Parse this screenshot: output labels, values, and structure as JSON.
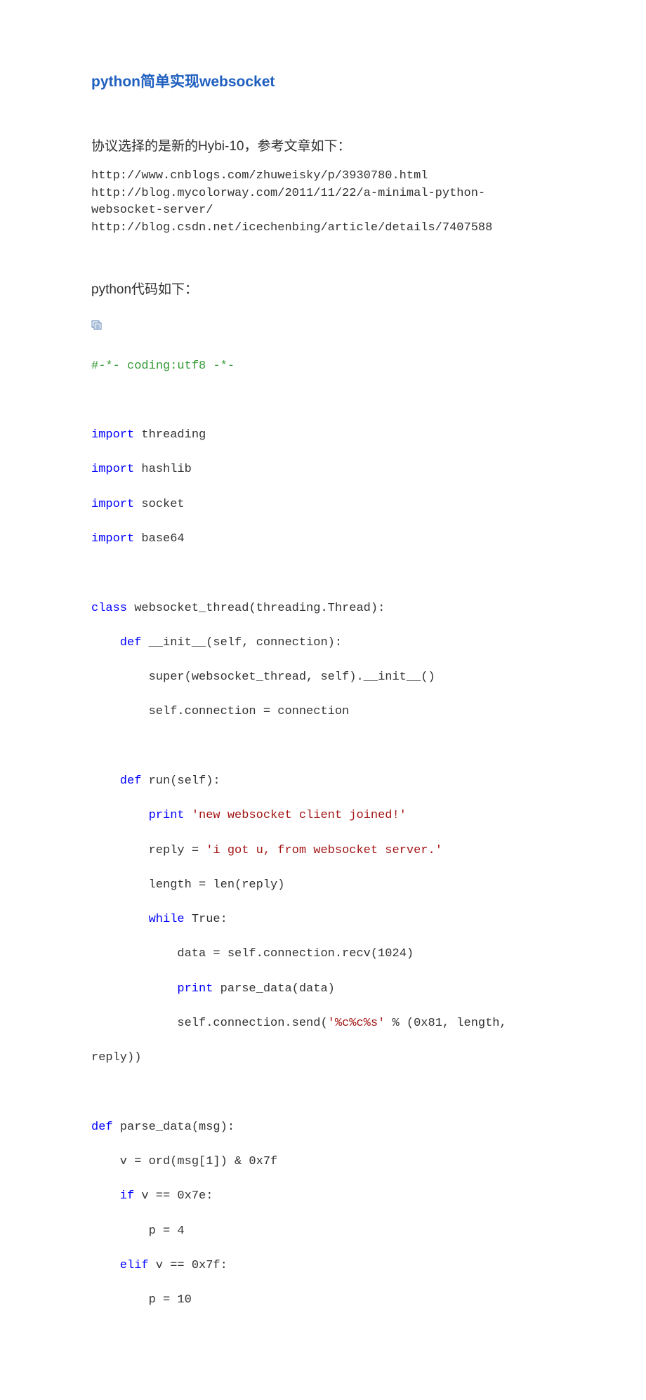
{
  "title": "python简单实现websocket",
  "intro": "协议选择的是新的Hybi-10，参考文章如下：",
  "urls": {
    "u1": "http://www.cnblogs.com/zhuweisky/p/3930780.html",
    "u2a": "http://blog.mycolorway.com/2011/11/22/a-minimal-python-",
    "u2b": "websocket-server/",
    "u3": "http://blog.csdn.net/icechenbing/article/details/7407588"
  },
  "code_heading": "python代码如下：",
  "code": {
    "coding_comment": "#-*- coding:utf8 -*-",
    "imp": "import",
    "threading": " threading",
    "hashlib": " hashlib",
    "socket": " socket",
    "base64": " base64",
    "class_kw": "class",
    "class_name": " websocket_thread(threading.Thread):",
    "def_kw": "def",
    "init_sig": " __init__(self, connection):",
    "super_line": "super(websocket_thread, self).__init__()",
    "selfconn_line": "self.connection = connection",
    "run_sig": " run(self):",
    "print_kw": "print",
    "print_joined": " 'new websocket client joined!'",
    "reply_lhs": "reply = ",
    "reply_str": "'i got u, from websocket server.'",
    "length_line": "length = len(reply)",
    "while_kw": "while",
    "while_rest": " True:",
    "data_line": "data = self.connection.recv(1024)",
    "print_parse": " parse_data(data)",
    "send_pre": "self.connection.send(",
    "send_str": "'%c%c%s'",
    "send_post": " % (0x81, length, ",
    "reply_close": "reply))",
    "parse_sig": " parse_data(msg):",
    "v_line": "v = ord(msg[1]) & 0x7f",
    "if_kw": "if",
    "if_cond": " v == 0x7e:",
    "p4": "p = 4",
    "elif_kw": "elif",
    "elif_cond": " v == 0x7f:",
    "p10": "p = 10"
  }
}
